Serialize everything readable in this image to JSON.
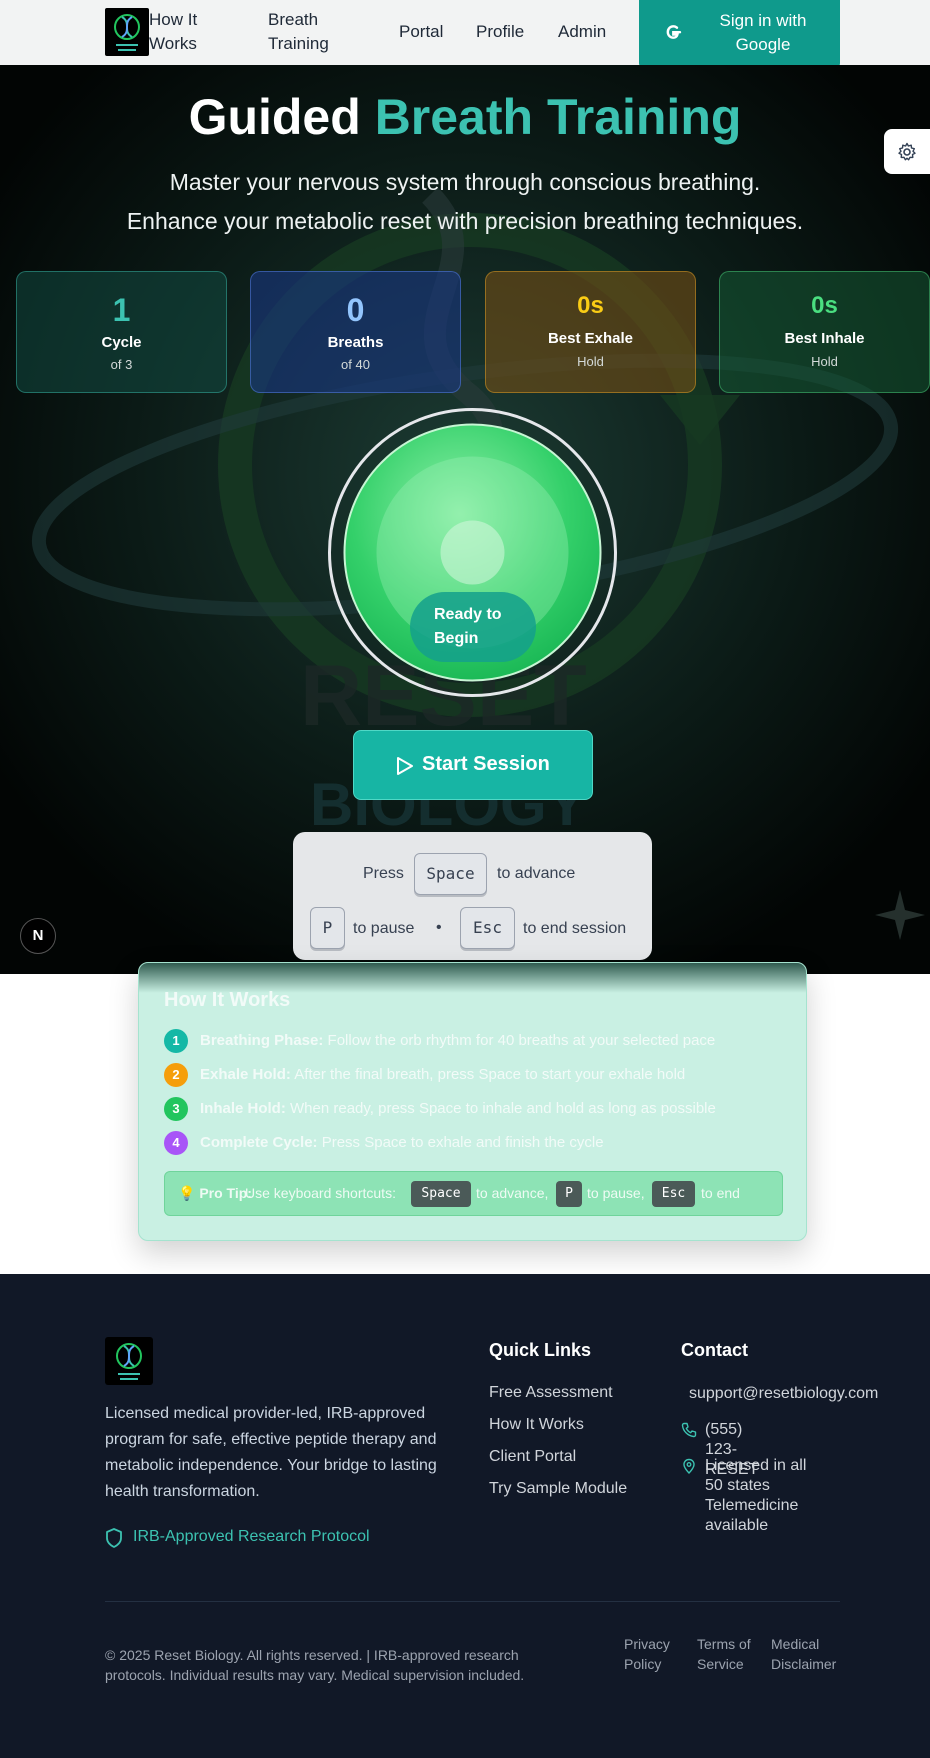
{
  "nav": {
    "logo_alt": "RESET BIOLOGY",
    "how_it_works": "How It Works",
    "breath_training": "Breath Training",
    "portal": "Portal",
    "profile": "Profile",
    "admin": "Admin",
    "sign_in": "Sign in with Google"
  },
  "hero": {
    "title_plain": "Guided",
    "title_accent": "Breath Training",
    "subtitle_line1": "Master your nervous system through conscious breathing.",
    "subtitle_line2": "Enhance your metabolic reset with precision breathing techniques."
  },
  "stats": [
    {
      "value": "1",
      "label": "Cycle",
      "sub": "of 3",
      "color": "#3cc2b1"
    },
    {
      "value": "0",
      "label": "Breaths",
      "sub": "of 40",
      "color": "#93c5fd"
    },
    {
      "value": "0s",
      "label": "Best Exhale",
      "sub": "Hold",
      "color": "#facc15"
    },
    {
      "value": "0s",
      "label": "Best Inhale",
      "sub": "Hold",
      "color": "#4ade80"
    }
  ],
  "breath_circle": {
    "status": "Ready to Begin"
  },
  "controls": {
    "start_label": "Start Session"
  },
  "shortcuts": {
    "press": "Press",
    "space": "Space",
    "to_advance": "to advance",
    "p": "P",
    "to_pause": "to pause",
    "bullet": "•",
    "esc": "Esc",
    "to_end_session": "to end session"
  },
  "dev_badge": "N",
  "how_it_works": {
    "title": "How It Works",
    "steps": [
      {
        "num": "1",
        "title": "Breathing Phase:",
        "text": "Follow the orb rhythm for 40 breaths at your selected pace",
        "color": "#14b8a6"
      },
      {
        "num": "2",
        "title": "Exhale Hold:",
        "text": "After the final breath, press Space to start your exhale hold",
        "color": "#f59e0b"
      },
      {
        "num": "3",
        "title": "Inhale Hold:",
        "text": "When ready, press Space to inhale and hold as long as possible",
        "color": "#22c55e"
      },
      {
        "num": "4",
        "title": "Complete Cycle:",
        "text": "Press Space to exhale and finish the cycle",
        "color": "#a855f7"
      }
    ],
    "tip": {
      "label": "💡 Pro Tip:",
      "text1": "Use keyboard shortcuts:",
      "key1": "Space",
      "text2": "to advance,",
      "key2": "P",
      "text3": "to pause,",
      "key3": "Esc",
      "text4": "to end"
    }
  },
  "footer": {
    "description": "Licensed medical provider-led, IRB-approved program for safe, effective peptide therapy and metabolic independence. Your bridge to lasting health transformation.",
    "irb": "IRB-Approved Research Protocol",
    "quick_links_title": "Quick Links",
    "quick_links": [
      "Free Assessment",
      "How It Works",
      "Client Portal",
      "Try Sample Module"
    ],
    "contact_title": "Contact",
    "email": "support@resetbiology.com",
    "phone": "(555) 123-RESET",
    "location": "Licensed in all 50 states Telemedicine available",
    "copyright": "© 2025 Reset Biology. All rights reserved. | IRB-approved research protocols. Individual results may vary. Medical supervision included.",
    "legal": [
      "Privacy Policy",
      "Terms of Service",
      "Medical Disclaimer"
    ]
  }
}
